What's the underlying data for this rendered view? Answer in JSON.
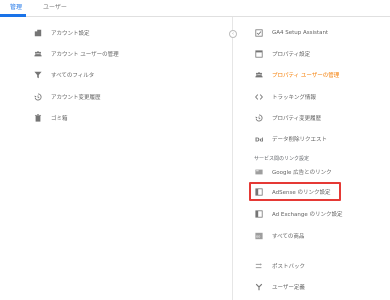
{
  "tabs": [
    {
      "label": "管理",
      "active": true
    },
    {
      "label": "ユーザー",
      "active": false
    }
  ],
  "left_menu": [
    {
      "label": "アカウント設定",
      "icon": "building-icon"
    },
    {
      "label": "アカウント ユーザーの管理",
      "icon": "people-icon"
    },
    {
      "label": "すべてのフィルタ",
      "icon": "filter-icon"
    },
    {
      "label": "アカウント変更履歴",
      "icon": "history-icon"
    },
    {
      "label": "ゴミ箱",
      "icon": "trash-icon"
    }
  ],
  "right_menu": [
    {
      "label": "GA4 Setup Assistant",
      "icon": "checklist-icon"
    },
    {
      "label": "プロパティ設定",
      "icon": "property-icon"
    },
    {
      "label": "プロパティ ユーザーの管理",
      "icon": "people-icon",
      "selected": true
    },
    {
      "label": "トラッキング情報",
      "icon": "code-icon"
    },
    {
      "label": "プロパティ変更履歴",
      "icon": "history-icon"
    },
    {
      "label": "データ削除リクエスト",
      "icon": "data-delete-icon"
    }
  ],
  "section_title": "サービス間のリンク設定",
  "link_menu": [
    {
      "label": "Google 広告とのリンク",
      "icon": "google-ads-icon"
    },
    {
      "label": "AdSense のリンク設定",
      "icon": "adsense-icon",
      "highlighted": true
    },
    {
      "label": "Ad Exchange のリンク設定",
      "icon": "ad-exchange-icon"
    },
    {
      "label": "すべての商品",
      "icon": "all-products-icon"
    }
  ],
  "extra_menu": [
    {
      "label": "ポストバック",
      "icon": "postback-icon"
    },
    {
      "label": "ユーザー定義",
      "icon": "custom-definitions-icon"
    }
  ],
  "colors": {
    "accent": "#1a73e8",
    "selected": "#f57c00",
    "highlight": "#e53935"
  }
}
